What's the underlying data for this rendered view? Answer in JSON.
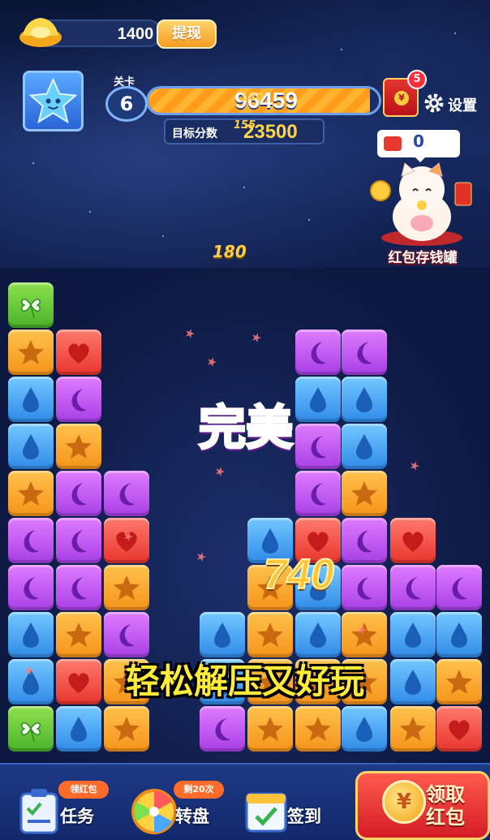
{
  "hud": {
    "gold_amount": "1400",
    "withdraw_label": "提现",
    "level_label": "关卡",
    "level_number": "6",
    "score": "96459",
    "score_float": "180",
    "score_progress": 0.96,
    "target_label": "目标分数",
    "target_score": "23500",
    "target_float": "155"
  },
  "red_packet": {
    "badge_count": "5",
    "savings_count": "0",
    "savings_label": "红包存钱罐"
  },
  "settings": {
    "label": "设置"
  },
  "board": {
    "combo_float": "180",
    "perfect_text": "完美",
    "score_pop": "740",
    "caption": "轻松解压又好玩",
    "tile_colors": {
      "green": "#5cc234",
      "red": "#f04a3c",
      "orange": "#f8a52a",
      "blue": "#3f9af0",
      "purple": "#b84df0"
    },
    "icons": {
      "green": "clover-icon",
      "red": "heart-icon",
      "orange": "star-icon",
      "blue": "drop-icon",
      "purple": "moon-icon"
    }
  },
  "bottom_nav": {
    "task": {
      "tag": "领红包",
      "label": "任务"
    },
    "wheel": {
      "tag": "剩20次",
      "label": "转盘"
    },
    "checkin": {
      "label": "签到"
    },
    "claim": {
      "label": "领取红包"
    }
  }
}
